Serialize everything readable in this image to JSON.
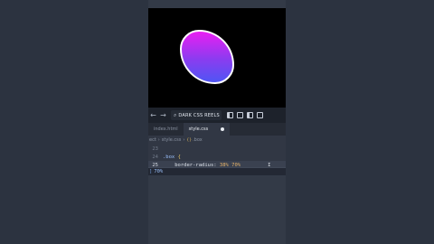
{
  "preview": {
    "shape_gradient": [
      "#e91ff2",
      "#8a3cf0",
      "#4f55f4"
    ],
    "shape_border_color": "#ffffff"
  },
  "toolbar": {
    "back_icon": "←",
    "forward_icon": "→",
    "search_icon": "⌕",
    "search_text": "DARK CSS REELS"
  },
  "tabs": [
    {
      "label": "index.html",
      "active": false
    },
    {
      "label": "style.css",
      "active": true
    }
  ],
  "breadcrumb": {
    "part0": "ect",
    "sep0": "›",
    "file": "style.css",
    "sep1": "›",
    "symbol_icon": "{}",
    "symbol": ".box"
  },
  "editor": {
    "lines": [
      {
        "num": "23",
        "text": ""
      },
      {
        "num": "24",
        "selector": ".box",
        "brace": "{"
      },
      {
        "num": "25",
        "property": "border-radius:",
        "value": "38% 70%"
      }
    ],
    "cursor": "I",
    "suggestion_marker": "]",
    "suggestion": "70%"
  }
}
